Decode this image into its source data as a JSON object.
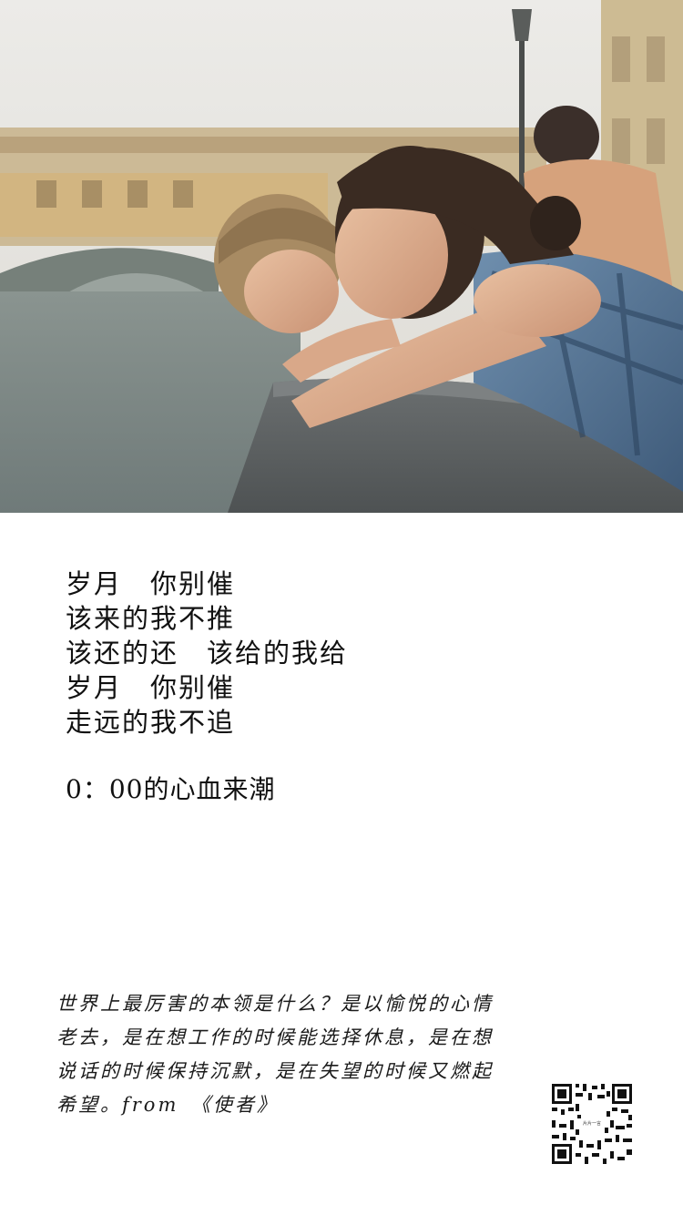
{
  "photo": {
    "icon": "photo-image",
    "description_colors": {
      "sky": "#e6e6e2",
      "river": "#7d8886",
      "railing": "#5e6263"
    }
  },
  "poem": {
    "lines": [
      "岁月　你别催",
      "该来的我不推",
      "该还的还　该给的我给",
      "岁月　你别催",
      "走远的我不追"
    ],
    "signature": "0：00的心血来潮"
  },
  "quote": {
    "text": "世界上最厉害的本领是什么？是以愉悦的心情老去，是在想工作的时候能选择休息，是在想说话的时候保持沉默，是在失望的时候又燃起希望。from　《使者》"
  },
  "qr": {
    "icon": "qr-code-icon",
    "center_label": "片片一言"
  }
}
